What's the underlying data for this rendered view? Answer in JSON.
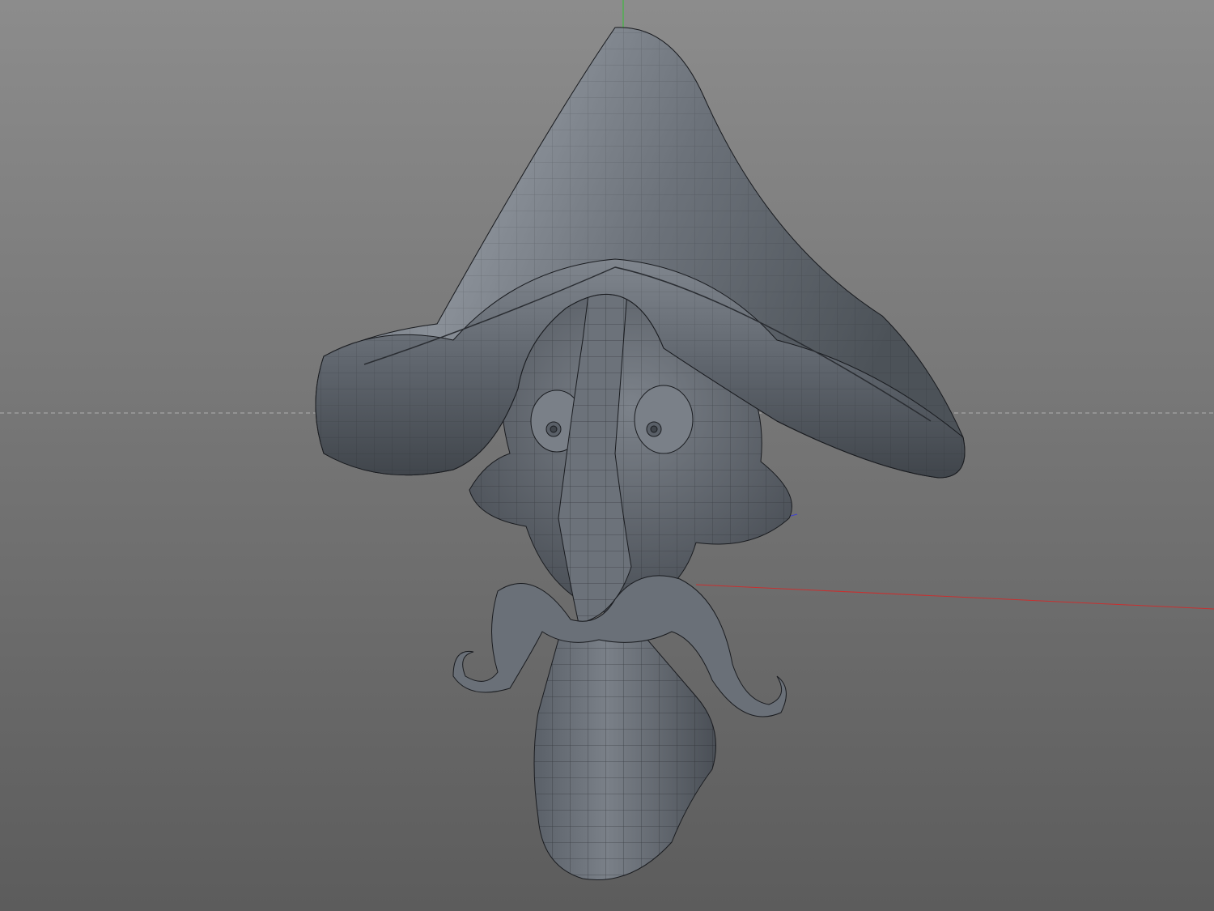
{
  "viewport": {
    "view": "perspective",
    "background_top": "#8c8c8c",
    "background_bottom": "#5c5c5c",
    "axis_x_color": "#c83030",
    "axis_y_color": "#30c030",
    "axis_z_color": "#4040d0",
    "horizon_color": "#b0b0b0",
    "model": {
      "icon": "3d-mesh-icon",
      "surface_color": "#6e747c",
      "wire_color": "#1a1c20"
    }
  }
}
